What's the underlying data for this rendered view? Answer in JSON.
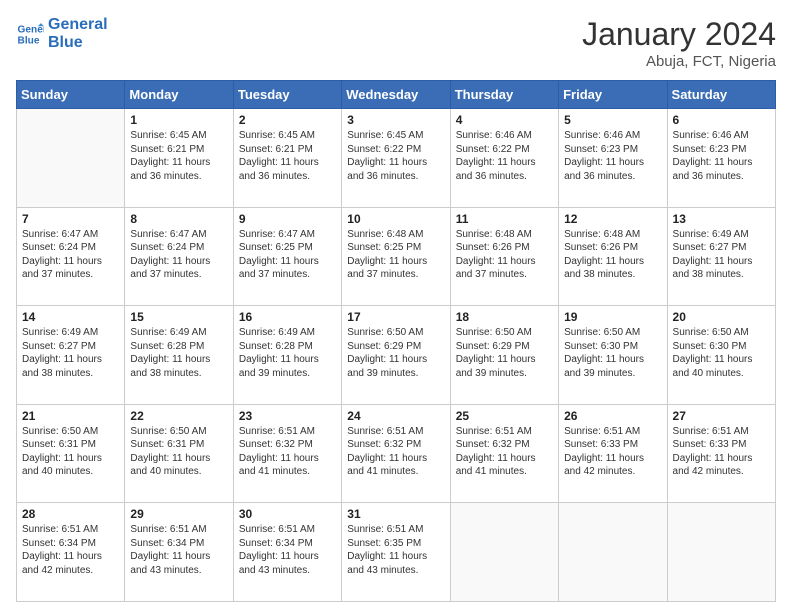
{
  "header": {
    "logo_line1": "General",
    "logo_line2": "Blue",
    "month_title": "January 2024",
    "subtitle": "Abuja, FCT, Nigeria"
  },
  "weekdays": [
    "Sunday",
    "Monday",
    "Tuesday",
    "Wednesday",
    "Thursday",
    "Friday",
    "Saturday"
  ],
  "weeks": [
    [
      {
        "day": "",
        "sunrise": "",
        "sunset": "",
        "daylight": ""
      },
      {
        "day": "1",
        "sunrise": "6:45 AM",
        "sunset": "6:21 PM",
        "daylight": "11 hours and 36 minutes."
      },
      {
        "day": "2",
        "sunrise": "6:45 AM",
        "sunset": "6:21 PM",
        "daylight": "11 hours and 36 minutes."
      },
      {
        "day": "3",
        "sunrise": "6:45 AM",
        "sunset": "6:22 PM",
        "daylight": "11 hours and 36 minutes."
      },
      {
        "day": "4",
        "sunrise": "6:46 AM",
        "sunset": "6:22 PM",
        "daylight": "11 hours and 36 minutes."
      },
      {
        "day": "5",
        "sunrise": "6:46 AM",
        "sunset": "6:23 PM",
        "daylight": "11 hours and 36 minutes."
      },
      {
        "day": "6",
        "sunrise": "6:46 AM",
        "sunset": "6:23 PM",
        "daylight": "11 hours and 36 minutes."
      }
    ],
    [
      {
        "day": "7",
        "sunrise": "6:47 AM",
        "sunset": "6:24 PM",
        "daylight": "11 hours and 37 minutes."
      },
      {
        "day": "8",
        "sunrise": "6:47 AM",
        "sunset": "6:24 PM",
        "daylight": "11 hours and 37 minutes."
      },
      {
        "day": "9",
        "sunrise": "6:47 AM",
        "sunset": "6:25 PM",
        "daylight": "11 hours and 37 minutes."
      },
      {
        "day": "10",
        "sunrise": "6:48 AM",
        "sunset": "6:25 PM",
        "daylight": "11 hours and 37 minutes."
      },
      {
        "day": "11",
        "sunrise": "6:48 AM",
        "sunset": "6:26 PM",
        "daylight": "11 hours and 37 minutes."
      },
      {
        "day": "12",
        "sunrise": "6:48 AM",
        "sunset": "6:26 PM",
        "daylight": "11 hours and 38 minutes."
      },
      {
        "day": "13",
        "sunrise": "6:49 AM",
        "sunset": "6:27 PM",
        "daylight": "11 hours and 38 minutes."
      }
    ],
    [
      {
        "day": "14",
        "sunrise": "6:49 AM",
        "sunset": "6:27 PM",
        "daylight": "11 hours and 38 minutes."
      },
      {
        "day": "15",
        "sunrise": "6:49 AM",
        "sunset": "6:28 PM",
        "daylight": "11 hours and 38 minutes."
      },
      {
        "day": "16",
        "sunrise": "6:49 AM",
        "sunset": "6:28 PM",
        "daylight": "11 hours and 39 minutes."
      },
      {
        "day": "17",
        "sunrise": "6:50 AM",
        "sunset": "6:29 PM",
        "daylight": "11 hours and 39 minutes."
      },
      {
        "day": "18",
        "sunrise": "6:50 AM",
        "sunset": "6:29 PM",
        "daylight": "11 hours and 39 minutes."
      },
      {
        "day": "19",
        "sunrise": "6:50 AM",
        "sunset": "6:30 PM",
        "daylight": "11 hours and 39 minutes."
      },
      {
        "day": "20",
        "sunrise": "6:50 AM",
        "sunset": "6:30 PM",
        "daylight": "11 hours and 40 minutes."
      }
    ],
    [
      {
        "day": "21",
        "sunrise": "6:50 AM",
        "sunset": "6:31 PM",
        "daylight": "11 hours and 40 minutes."
      },
      {
        "day": "22",
        "sunrise": "6:50 AM",
        "sunset": "6:31 PM",
        "daylight": "11 hours and 40 minutes."
      },
      {
        "day": "23",
        "sunrise": "6:51 AM",
        "sunset": "6:32 PM",
        "daylight": "11 hours and 41 minutes."
      },
      {
        "day": "24",
        "sunrise": "6:51 AM",
        "sunset": "6:32 PM",
        "daylight": "11 hours and 41 minutes."
      },
      {
        "day": "25",
        "sunrise": "6:51 AM",
        "sunset": "6:32 PM",
        "daylight": "11 hours and 41 minutes."
      },
      {
        "day": "26",
        "sunrise": "6:51 AM",
        "sunset": "6:33 PM",
        "daylight": "11 hours and 42 minutes."
      },
      {
        "day": "27",
        "sunrise": "6:51 AM",
        "sunset": "6:33 PM",
        "daylight": "11 hours and 42 minutes."
      }
    ],
    [
      {
        "day": "28",
        "sunrise": "6:51 AM",
        "sunset": "6:34 PM",
        "daylight": "11 hours and 42 minutes."
      },
      {
        "day": "29",
        "sunrise": "6:51 AM",
        "sunset": "6:34 PM",
        "daylight": "11 hours and 43 minutes."
      },
      {
        "day": "30",
        "sunrise": "6:51 AM",
        "sunset": "6:34 PM",
        "daylight": "11 hours and 43 minutes."
      },
      {
        "day": "31",
        "sunrise": "6:51 AM",
        "sunset": "6:35 PM",
        "daylight": "11 hours and 43 minutes."
      },
      {
        "day": "",
        "sunrise": "",
        "sunset": "",
        "daylight": ""
      },
      {
        "day": "",
        "sunrise": "",
        "sunset": "",
        "daylight": ""
      },
      {
        "day": "",
        "sunrise": "",
        "sunset": "",
        "daylight": ""
      }
    ]
  ],
  "labels": {
    "sunrise_prefix": "Sunrise: ",
    "sunset_prefix": "Sunset: ",
    "daylight_prefix": "Daylight: "
  }
}
